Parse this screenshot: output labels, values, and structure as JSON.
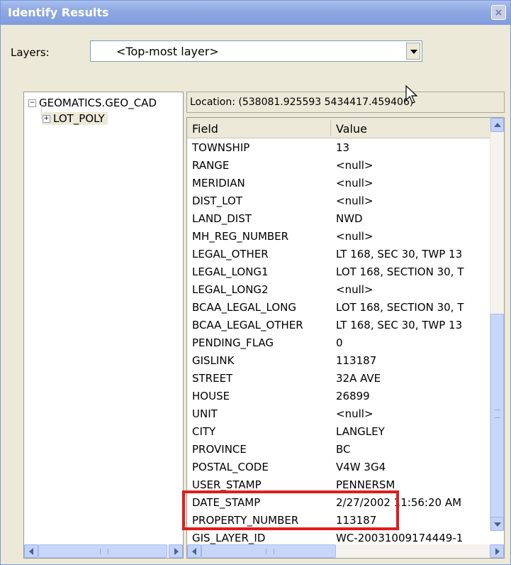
{
  "window": {
    "title": "Identify Results",
    "close_label": "×"
  },
  "layers": {
    "label": "Layers:",
    "selected": "<Top-most layer>"
  },
  "tree": {
    "root": "GEOMATICS.GEO_CAD",
    "root_expander": "−",
    "child": "LOT_POLY",
    "child_expander": "+"
  },
  "location": "Location: (538081.925593 5434417.459406)",
  "grid": {
    "headers": {
      "field": "Field",
      "value": "Value"
    },
    "rows": [
      {
        "field": "TOWNSHIP",
        "value": "13"
      },
      {
        "field": "RANGE",
        "value": "<null>"
      },
      {
        "field": "MERIDIAN",
        "value": "<null>"
      },
      {
        "field": "DIST_LOT",
        "value": "<null>"
      },
      {
        "field": "LAND_DIST",
        "value": "NWD"
      },
      {
        "field": "MH_REG_NUMBER",
        "value": "<null>"
      },
      {
        "field": "LEGAL_OTHER",
        "value": "LT 168, SEC 30, TWP 13"
      },
      {
        "field": "LEGAL_LONG1",
        "value": "LOT 168, SECTION 30, T"
      },
      {
        "field": "LEGAL_LONG2",
        "value": "<null>"
      },
      {
        "field": "BCAA_LEGAL_LONG",
        "value": "LOT 168, SECTION 30, T"
      },
      {
        "field": "BCAA_LEGAL_OTHER",
        "value": "LT 168, SEC 30, TWP 13"
      },
      {
        "field": "PENDING_FLAG",
        "value": "0"
      },
      {
        "field": "GISLINK",
        "value": "113187"
      },
      {
        "field": "STREET",
        "value": "32A AVE"
      },
      {
        "field": "HOUSE",
        "value": "26899"
      },
      {
        "field": "UNIT",
        "value": "<null>"
      },
      {
        "field": "CITY",
        "value": "LANGLEY"
      },
      {
        "field": "PROVINCE",
        "value": "BC"
      },
      {
        "field": "POSTAL_CODE",
        "value": "V4W 3G4"
      },
      {
        "field": "USER_STAMP",
        "value": "PENNERSM"
      },
      {
        "field": "DATE_STAMP",
        "value": "2/27/2002 11:56:20 AM"
      },
      {
        "field": "PROPERTY_NUMBER",
        "value": "113187"
      },
      {
        "field": "GIS_LAYER_ID",
        "value": "WC-20031009174449-1"
      }
    ]
  },
  "colors": {
    "highlight": "#e11c1c",
    "titlebar": "#8fa9e3",
    "window_bg": "#ece9d8"
  }
}
